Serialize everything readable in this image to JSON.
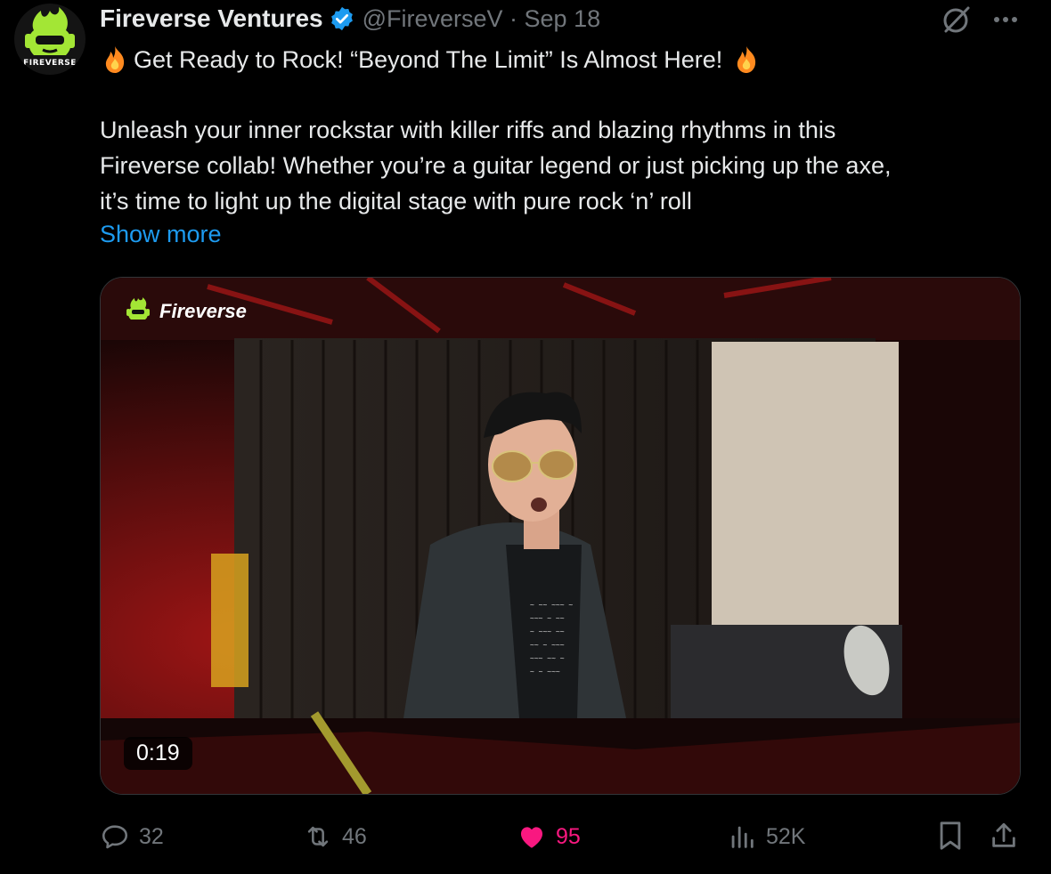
{
  "tweet": {
    "author_name": "Fireverse Ventures",
    "handle_date": "@FireverseV · Sep 18",
    "avatar_label": "FIREVERSE",
    "headline": "Get Ready to Rock! “Beyond The Limit” Is Almost Here!",
    "body": "Unleash your inner rockstar with killer riffs and blazing rhythms in this\nFireverse collab! Whether you’re a guitar legend or just picking up the axe,\nit’s time to light up the digital stage with pure rock ‘n’ roll",
    "show_more": "Show more"
  },
  "media": {
    "brand": "Fireverse",
    "duration": "0:19"
  },
  "actions": {
    "replies": "32",
    "reposts": "46",
    "likes": "95",
    "views": "52K"
  },
  "colors": {
    "link": "#1d9bf0",
    "like": "#f91880",
    "verified": "#1d9bf0",
    "brand_green": "#a3e635"
  },
  "icons": [
    "verified-badge-icon",
    "grok-icon",
    "more-icon",
    "fire-emoji-icon",
    "reply-icon",
    "repost-icon",
    "like-icon",
    "views-icon",
    "bookmark-icon",
    "share-icon"
  ]
}
